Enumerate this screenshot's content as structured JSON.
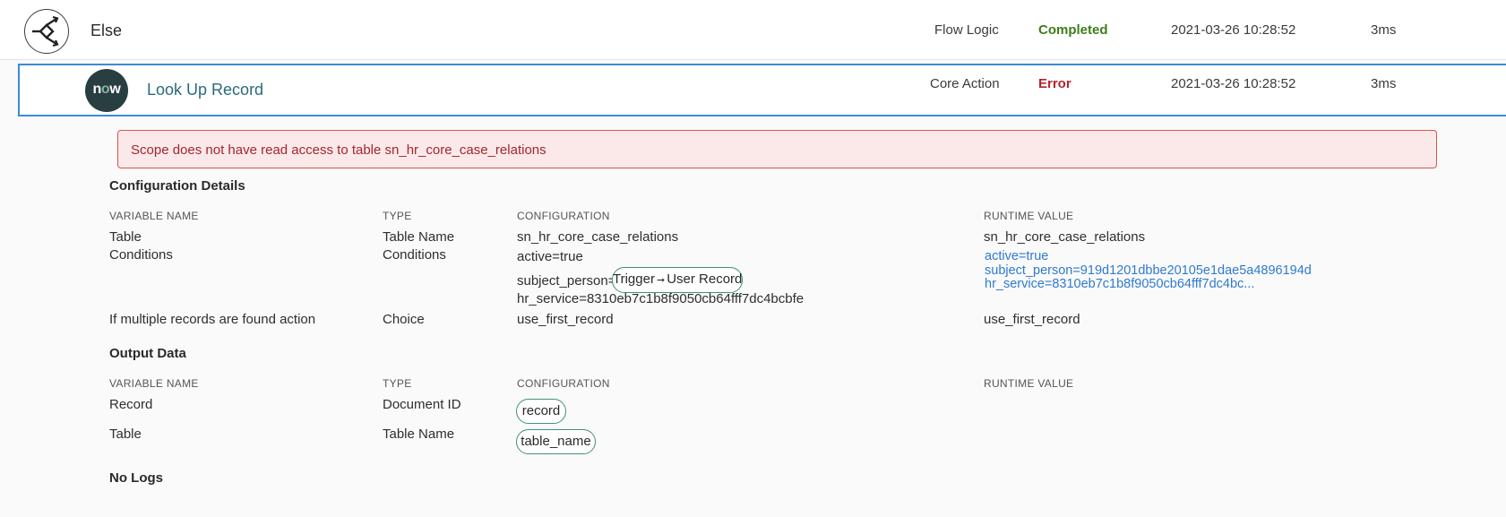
{
  "steps": [
    {
      "title": "Else",
      "type": "Flow Logic",
      "status": "Completed",
      "timestamp": "2021-03-26 10:28:52",
      "duration": "3ms",
      "icon": "branch-icon"
    },
    {
      "title": "Look Up Record",
      "type": "Core Action",
      "status": "Error",
      "timestamp": "2021-03-26 10:28:52",
      "duration": "3ms",
      "icon": "now-logo"
    }
  ],
  "logo": {
    "prefix": "n",
    "middle": "o",
    "suffix": "w"
  },
  "error_message": "Scope does not have read access to table sn_hr_core_case_relations",
  "configuration": {
    "title": "Configuration Details",
    "headers": {
      "variable": "VARIABLE NAME",
      "type": "TYPE",
      "configuration": "CONFIGURATION",
      "runtime": "RUNTIME VALUE"
    },
    "rows": [
      {
        "variable": "Table",
        "type": "Table Name",
        "configuration": "sn_hr_core_case_relations",
        "runtime": "sn_hr_core_case_relations"
      },
      {
        "variable": "Conditions",
        "type": "Conditions",
        "config_line1": "active=true",
        "config_line2_prefix": "subject_person=",
        "pill_part1": "Trigger",
        "pill_part2": "User Record",
        "config_line3": "hr_service=8310eb7c1b8f9050cb64fff7dc4bcbfe",
        "runtime_line1": "active=true",
        "runtime_line2": "subject_person=919d1201dbbe20105e1dae5a4896194d",
        "runtime_line3": "hr_service=8310eb7c1b8f9050cb64fff7dc4bc..."
      },
      {
        "variable": "If multiple records are found action",
        "type": "Choice",
        "configuration": "use_first_record",
        "runtime": "use_first_record"
      }
    ]
  },
  "output": {
    "title": "Output Data",
    "headers": {
      "variable": "VARIABLE NAME",
      "type": "TYPE",
      "configuration": "CONFIGURATION",
      "runtime": "RUNTIME VALUE"
    },
    "rows": [
      {
        "variable": "Record",
        "type": "Document ID",
        "pill": "record"
      },
      {
        "variable": "Table",
        "type": "Table Name",
        "pill": "table_name"
      }
    ]
  },
  "logs": {
    "title": "No Logs"
  },
  "colors": {
    "accent_border": "#3d8ad9",
    "completed": "#3e7d1a",
    "error": "#b0272c",
    "pill_border": "#3f8f7f",
    "link": "#2f7ad1"
  }
}
